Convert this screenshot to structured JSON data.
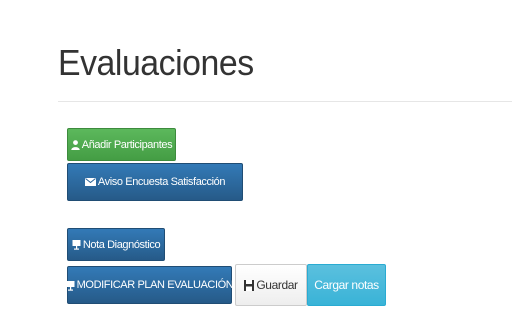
{
  "page": {
    "title": "Evaluaciones"
  },
  "buttons": {
    "add_participants": {
      "label": "Añadir Participantes",
      "icon": "user-icon"
    },
    "survey_notice": {
      "label": "Aviso Encuesta Satisfacción",
      "icon": "envelope-icon"
    },
    "diagnostic_grade": {
      "label": "Nota Diagnóstico",
      "icon": "clipboard-icon"
    },
    "modify_plan": {
      "label": "MODIFICAR PLAN EVALUACIÓN",
      "icon": "clipboard-icon"
    },
    "save": {
      "label": "Guardar",
      "icon": "floppy-disk-icon"
    },
    "load_grades": {
      "label": "Cargar notas"
    }
  },
  "colors": {
    "success": "#5cb85c",
    "primary": "#337ab7",
    "info": "#5bc0de",
    "default": "#ffffff",
    "title_text": "#333333"
  }
}
